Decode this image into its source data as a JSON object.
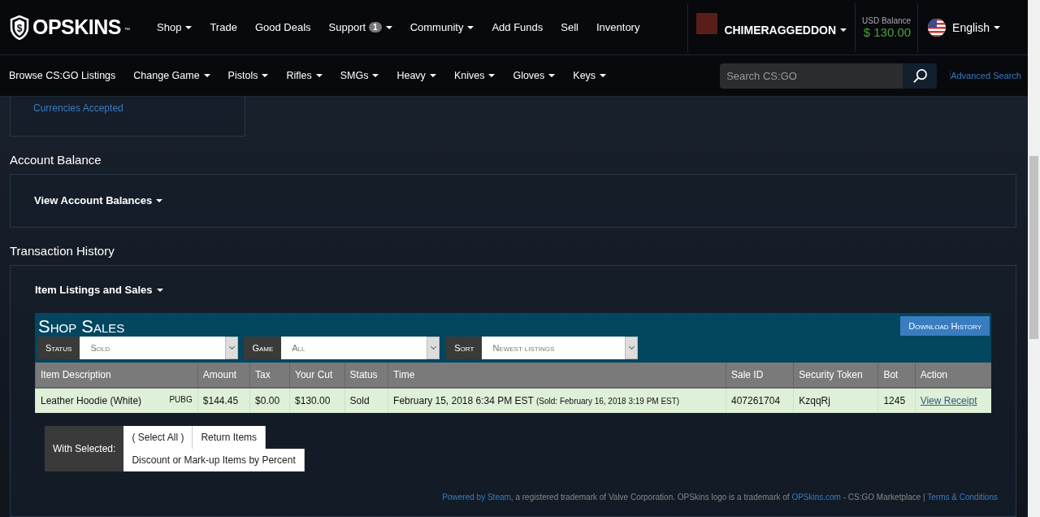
{
  "header": {
    "logo_symbol": "$",
    "logo": "OPSKINS",
    "trademark": "™",
    "nav": [
      {
        "label": "Shop",
        "dropdown": true
      },
      {
        "label": "Trade",
        "dropdown": false
      },
      {
        "label": "Good Deals",
        "dropdown": false
      },
      {
        "label": "Support",
        "dropdown": true,
        "badge": "1"
      },
      {
        "label": "Community",
        "dropdown": true
      },
      {
        "label": "Add Funds",
        "dropdown": false
      },
      {
        "label": "Sell",
        "dropdown": false
      },
      {
        "label": "Inventory",
        "dropdown": false
      }
    ],
    "username": "CHIMERAGGEDDON",
    "balance_label": "USD Balance",
    "balance": "$ 130.00",
    "language": "English"
  },
  "subnav": {
    "items": [
      {
        "label": "Browse CS:GO Listings",
        "dropdown": false
      },
      {
        "label": "Change Game",
        "dropdown": true
      },
      {
        "label": "Pistols",
        "dropdown": true
      },
      {
        "label": "Rifles",
        "dropdown": true
      },
      {
        "label": "SMGs",
        "dropdown": true
      },
      {
        "label": "Heavy",
        "dropdown": true
      },
      {
        "label": "Knives",
        "dropdown": true
      },
      {
        "label": "Gloves",
        "dropdown": true
      },
      {
        "label": "Keys",
        "dropdown": true
      }
    ],
    "search": {
      "placeholder": "Search CS:GO"
    },
    "advanced": "Advanced Search"
  },
  "currencies_link": "Currencies Accepted",
  "account_balance": {
    "heading": "Account Balance",
    "toggle": "View Account Balances"
  },
  "transactions": {
    "heading": "Transaction History",
    "toggle": "Item Listings and Sales",
    "shop_sales": {
      "title": "Shop Sales",
      "download": "Download History",
      "filters": [
        {
          "label": "Status",
          "value": "Sold"
        },
        {
          "label": "Game",
          "value": "All"
        },
        {
          "label": "Sort",
          "value": "Newest listings"
        }
      ],
      "columns": [
        "Item Description",
        "Amount",
        "Tax",
        "Your Cut",
        "Status",
        "Time",
        "Sale ID",
        "Security Token",
        "Bot",
        "Action"
      ],
      "rows": [
        {
          "item": "Leather Hoodie (White)",
          "game": "PUBG",
          "amount": "$144.45",
          "tax": "$0.00",
          "cut": "$130.00",
          "status": "Sold",
          "time": "February 15, 2018 6:34 PM EST",
          "sold": "(Sold: February 16, 2018 3:19 PM EST)",
          "sale_id": "407261704",
          "token": "KzqqRj",
          "bot": "1245",
          "action": "View Receipt"
        }
      ]
    },
    "with_selected": {
      "label": "With Selected:",
      "buttons": [
        "( Select All )",
        "Return Items",
        "Discount or Mark-up Items by Percent"
      ]
    }
  },
  "footer": {
    "link1": "Powered by Steam",
    "text1": ", a registered trademark of Valve Corporation. OPSkins logo is a trademark of ",
    "link2": "OPSkins.com",
    "text2": " - CS:GO Marketplace | ",
    "link3": "Terms & Conditions"
  }
}
